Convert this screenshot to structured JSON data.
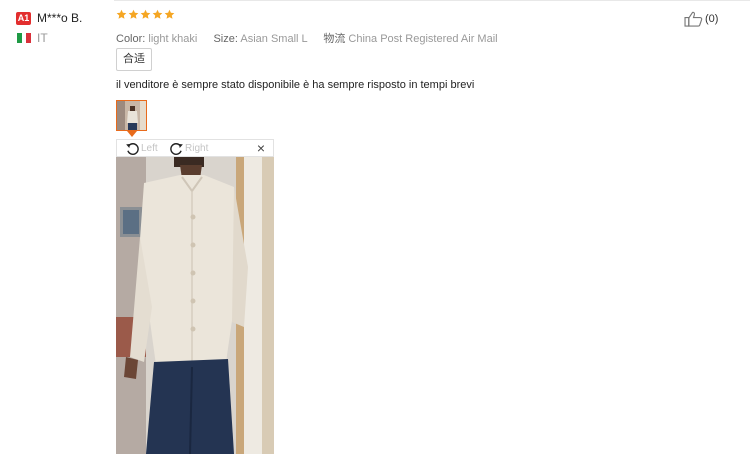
{
  "buyer": {
    "badge": "A1",
    "name": "M***o B.",
    "country": "IT"
  },
  "rating": {
    "stars": 5,
    "max": 5
  },
  "product": {
    "color_label": "Color:",
    "color_value": "light khaki",
    "size_label": "Size:",
    "size_value": "Asian Small L",
    "shipping_label": "物流",
    "shipping_value": "China Post Registered Air Mail"
  },
  "fit_tag": "合适",
  "comment": "il venditore è sempre stato disponibile è ha sempre risposto in tempi brevi",
  "viewer": {
    "rotate_left": "Left",
    "rotate_right": "Right",
    "close": "×"
  },
  "likes": {
    "count": "(0)"
  },
  "colors": {
    "accent": "#e86b1c",
    "star": "#f5a623",
    "badge": "#e22e2e"
  }
}
